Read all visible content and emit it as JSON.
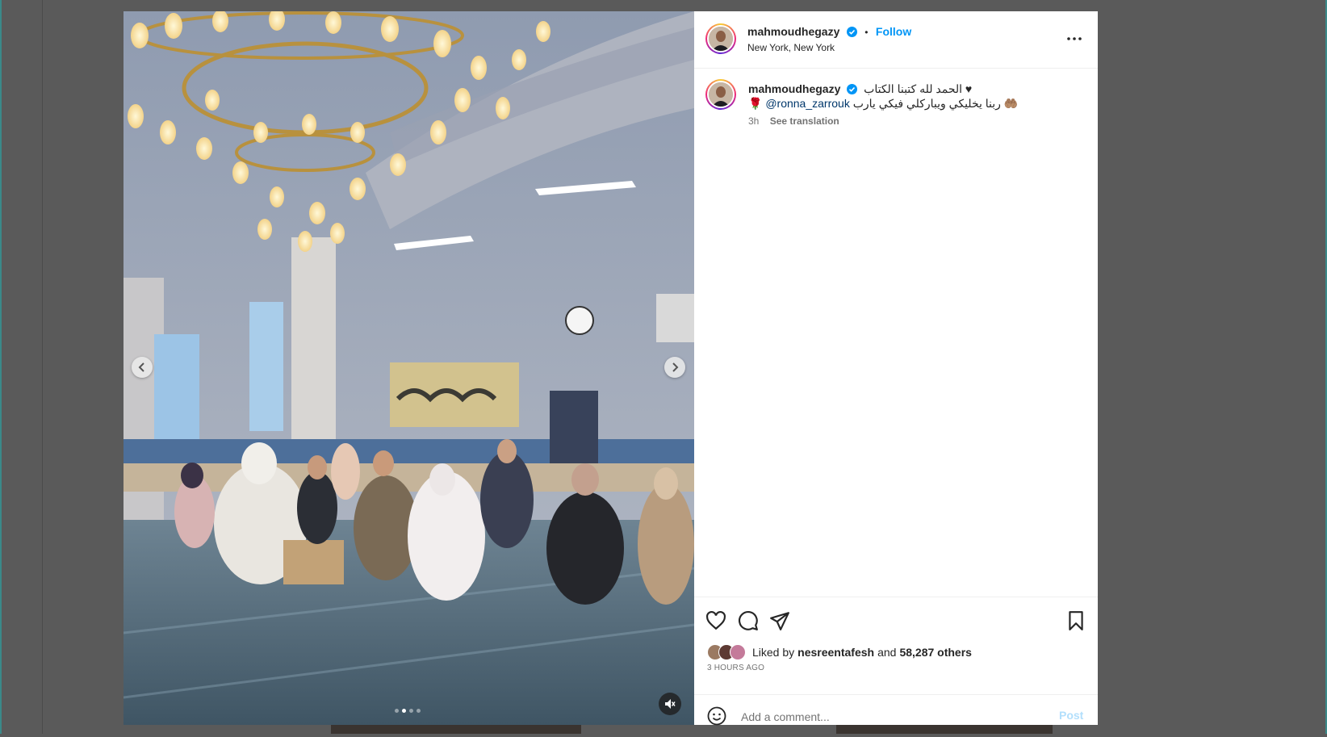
{
  "theme": {
    "accent": "#0095f6",
    "text": "#262626",
    "secondary": "#737373",
    "mention": "#00376b",
    "post_disabled": "#b2dffc"
  },
  "post_header": {
    "username": "mahmoudhegazy",
    "separator": "•",
    "follow_label": "Follow",
    "location": "New York, New York",
    "verified_icon": "verified-badge-icon",
    "more_icon": "more-options-icon"
  },
  "caption": {
    "username": "mahmoudhegazy",
    "line1": "الحمد لله كتبنا الكتاب ♥",
    "line2_before": "ربنا يخليكي ويباركلي فيكي يارب 🤲🏽",
    "mention": "@ronna_zarrouk",
    "line2_after": "🌹",
    "time": "3h",
    "see_translation": "See translation"
  },
  "media": {
    "prev_icon": "chevron-left-icon",
    "next_icon": "chevron-right-icon",
    "mute_icon": "muted-speaker-icon",
    "carousel_count": 4,
    "carousel_active_index": 1
  },
  "actions": {
    "like_icon": "heart-icon",
    "comment_icon": "comment-bubble-icon",
    "share_icon": "paper-plane-icon",
    "save_icon": "bookmark-icon"
  },
  "likes": {
    "prefix": "Liked by",
    "liked_user": "nesreentafesh",
    "conjunction": "and",
    "others": "58,287 others"
  },
  "timestamp": "3 HOURS AGO",
  "comment": {
    "placeholder": "Add a comment...",
    "post_label": "Post",
    "emoji_icon": "smiley-face-icon"
  }
}
